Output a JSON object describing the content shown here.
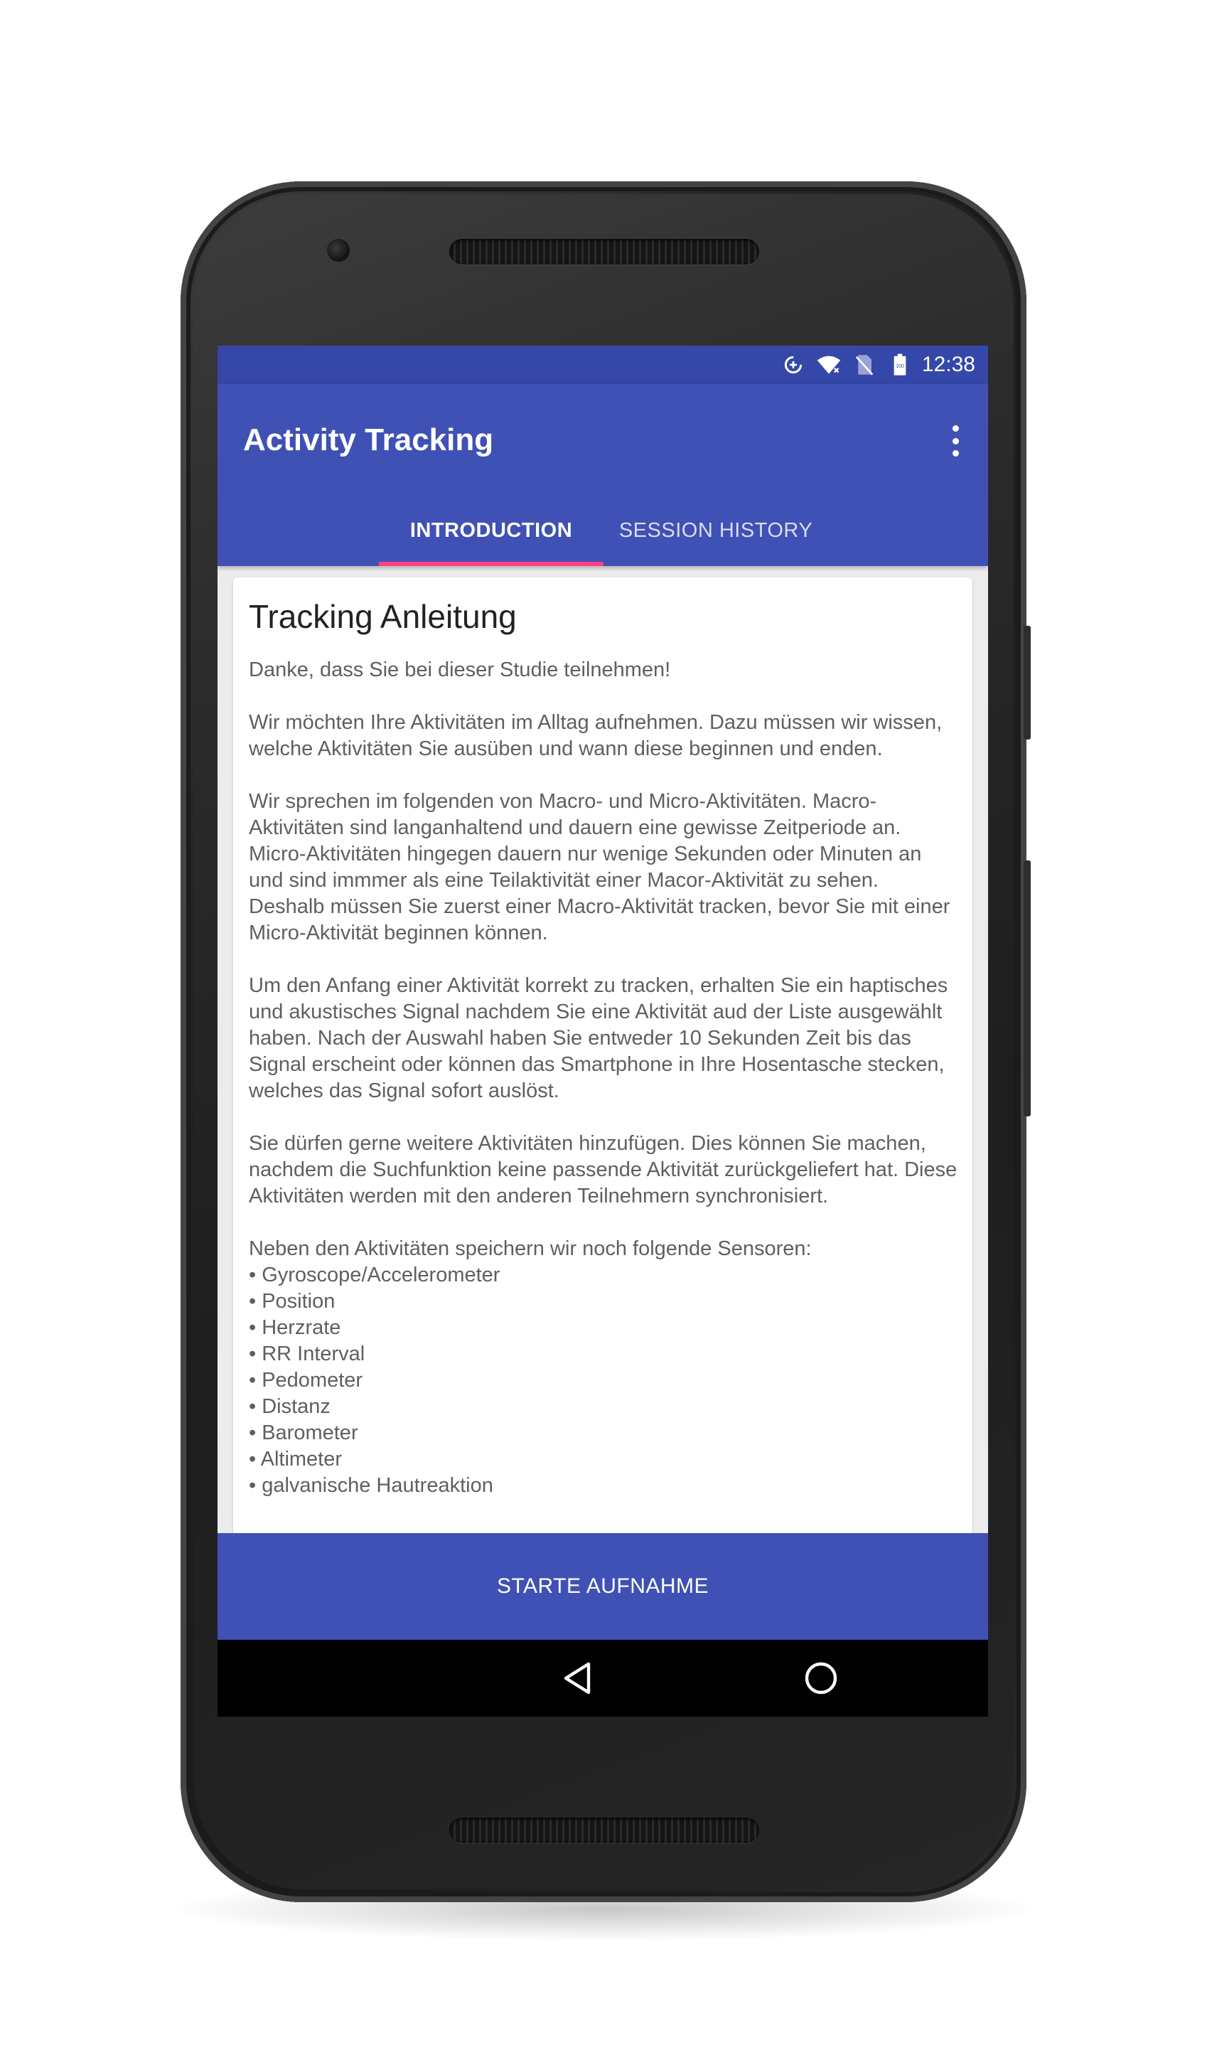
{
  "status_bar": {
    "icons": [
      "data-saver-icon",
      "wifi-icon",
      "no-sim-icon",
      "battery-icon"
    ],
    "time": "12:38"
  },
  "app_bar": {
    "title": "Activity Tracking",
    "overflow_icon": "more-vert-icon"
  },
  "tabs": [
    {
      "label": "INTRODUCTION",
      "selected": true
    },
    {
      "label": "SESSION HISTORY",
      "selected": false
    }
  ],
  "card": {
    "title": "Tracking Anleitung",
    "intro": "Danke, dass Sie bei dieser Studie teilnehmen!",
    "paragraphs": [
      "Wir möchten Ihre Aktivitäten im Alltag aufnehmen. Dazu müssen wir wissen, welche Aktivitäten Sie ausüben und wann diese beginnen und enden.",
      "Wir sprechen im folgenden von Macro- und Micro-Aktivitäten. Macro-Aktivitäten sind langanhaltend und dauern eine gewisse Zeitperiode an. Micro-Aktivitäten hingegen dauern nur wenige Sekunden oder Minuten an und sind immmer als eine Teilaktivität einer Macor-Aktivität zu sehen. Deshalb müssen Sie zuerst einer Macro-Aktivität tracken, bevor Sie mit einer Micro-Aktivität beginnen können.",
      "Um den Anfang einer Aktivität korrekt zu tracken, erhalten Sie ein haptisches und akustisches Signal nachdem Sie eine Aktivität aud der Liste ausgewählt haben. Nach der Auswahl haben Sie entweder 10 Sekunden Zeit bis das Signal erscheint oder können das Smartphone in Ihre Hosentasche stecken, welches das Signal sofort auslöst.",
      "Sie dürfen gerne weitere Aktivitäten hinzufügen. Dies können Sie machen, nachdem die Suchfunktion keine passende Aktivität zurückgeliefert hat. Diese Aktivitäten werden mit den anderen Teilnehmern synchronisiert."
    ],
    "sensors_intro": "Neben den Aktivitäten speichern wir noch folgende Sensoren:",
    "sensors": [
      "• Gyroscope/Accelerometer",
      "• Position",
      "• Herzrate",
      "• RR Interval",
      "• Pedometer",
      "• Distanz",
      "• Barometer",
      "• Altimeter",
      "• galvanische Hautreaktion"
    ]
  },
  "start_button": {
    "label": "STARTE AUFNAHME"
  },
  "nav_bar": {
    "icons": [
      "back-icon",
      "home-icon",
      "recents-icon"
    ]
  },
  "colors": {
    "primary": "#3f51b5",
    "primary_dark": "#3547a8",
    "accent": "#ff4081",
    "background": "#ececec"
  }
}
